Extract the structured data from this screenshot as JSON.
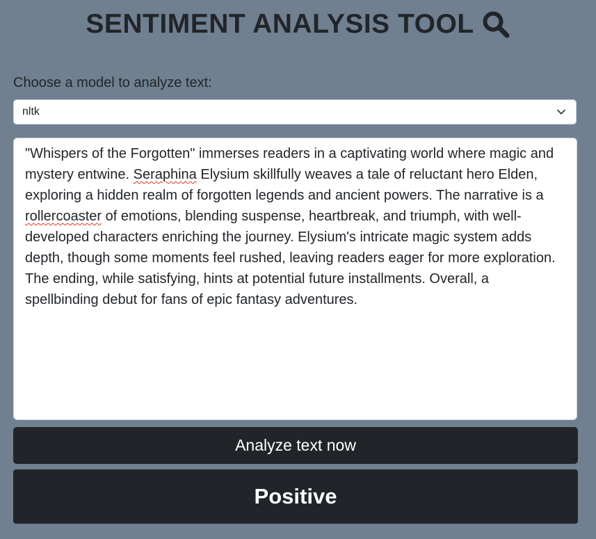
{
  "header": {
    "title": "SENTIMENT ANALYSIS TOOL",
    "icon": "search-icon"
  },
  "model_select": {
    "label": "Choose a model to analyze text:",
    "selected": "nltk"
  },
  "text_input": {
    "segments": [
      "\"Whispers of the Forgotten\" immerses readers in a captivating world where magic and mystery entwine. ",
      "Seraphina",
      " Elysium skillfully weaves a tale of reluctant hero Elden, exploring a hidden realm of forgotten legends and ancient powers. The narrative is a ",
      "rollercoaster",
      " of emotions, blending suspense, heartbreak, and triumph, with well-developed characters enriching the journey. Elysium's intricate magic system adds depth, though some moments feel rushed, leaving readers eager for more exploration. The ending, while satisfying, hints at potential future installments. Overall, a spellbinding debut for fans of epic fantasy adventures."
    ]
  },
  "actions": {
    "analyze_label": "Analyze text now"
  },
  "result": {
    "sentiment": "Positive"
  },
  "colors": {
    "background": "#708090",
    "dark": "#212529",
    "input_bg": "#ffffff",
    "spell_underline": "#e0301e"
  }
}
